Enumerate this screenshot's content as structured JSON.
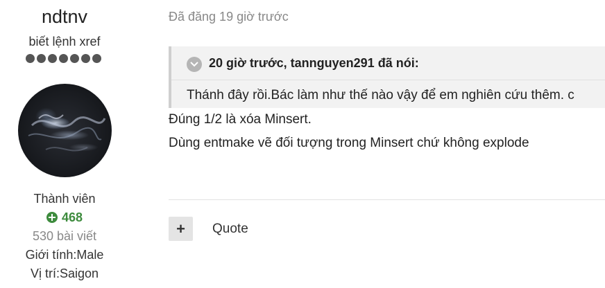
{
  "author": {
    "username": "ndtnv",
    "user_title": "biết lệnh xref",
    "rank_dots": 7,
    "role": "Thành viên",
    "reputation": "468",
    "post_count": "530 bài viết",
    "gender": "Giới tính:Male",
    "location": "Vị trí:Saigon"
  },
  "post": {
    "posted_time": "Đã đăng 19 giờ trước",
    "quote": {
      "attribution": "20 giờ trước, tannguyen291 đã nói:",
      "text": "Thánh đây rồi.Bác làm như thế nào vậy để em nghiên cứu thêm. c"
    },
    "body_lines": [
      "Đúng 1/2 là xóa Minsert.",
      "Dùng entmake vẽ đối tượng trong Minsert chứ không explode"
    ]
  },
  "actions": {
    "plus_label": "+",
    "quote_label": "Quote"
  },
  "colors": {
    "reputation_green": "#3d8b3d",
    "quote_bg": "#f2f2f2",
    "quote_border": "#cfcfcf",
    "muted_text": "#888888"
  }
}
